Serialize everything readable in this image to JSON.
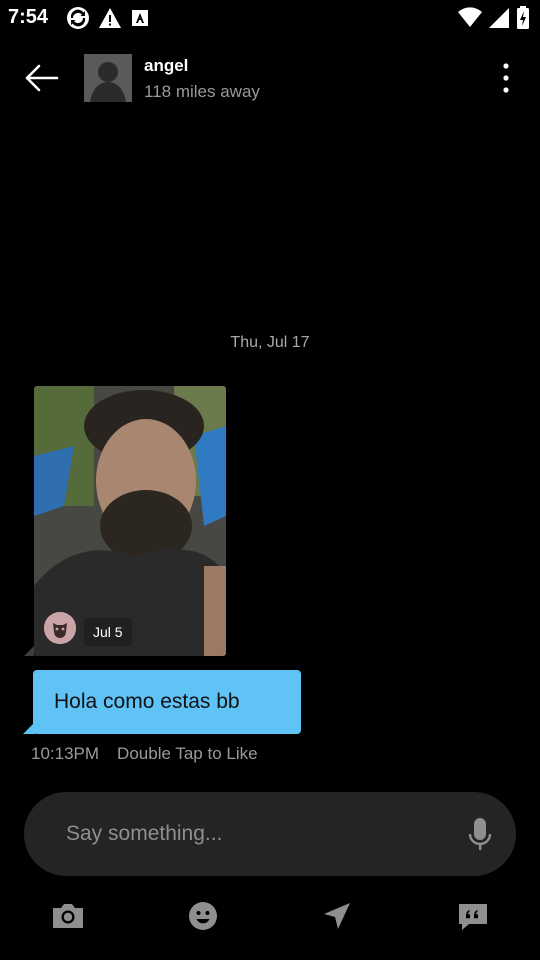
{
  "status_bar": {
    "time": "7:54",
    "icons_left": [
      "sync-icon",
      "warning-icon",
      "font-a-icon"
    ],
    "icons_right": [
      "wifi-icon",
      "signal-icon",
      "battery-icon"
    ]
  },
  "header": {
    "name": "angel",
    "distance": "118 miles away"
  },
  "chat": {
    "date_divider": "Thu, Jul 17",
    "photo_message": {
      "date_label": "Jul 5"
    },
    "text_message": {
      "text": "Hola como estas bb"
    },
    "time": "10:13PM",
    "like_hint": "Double Tap to Like"
  },
  "composer": {
    "placeholder": "Say something..."
  },
  "toolbar": {
    "items": [
      "camera-icon",
      "emoji-icon",
      "location-icon",
      "saved-phrases-icon"
    ]
  },
  "colors": {
    "background": "#000000",
    "bubble_accent": "#5fc3f5",
    "composer": "#242424",
    "secondary_text": "#9a9a9a"
  }
}
